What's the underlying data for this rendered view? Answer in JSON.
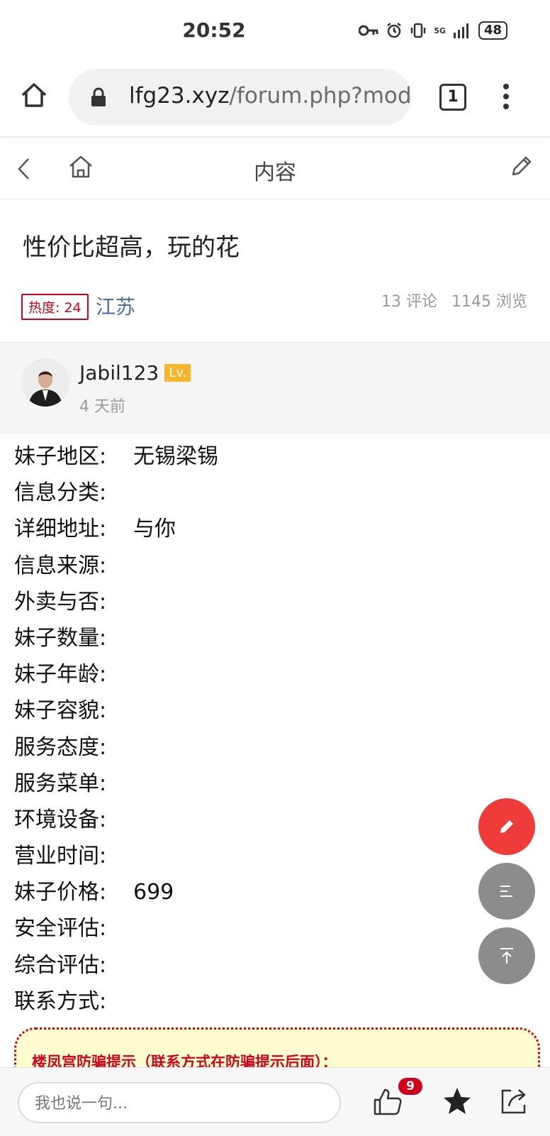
{
  "status_bar": {
    "time": "20:52",
    "network": "5G",
    "battery": "48"
  },
  "browser": {
    "url_domain": "lfg23.xyz",
    "url_path": "/forum.php?mod",
    "tab_count": "1"
  },
  "nav": {
    "title": "内容"
  },
  "post": {
    "title": "性价比超高，玩的花",
    "heat": "热度: 24",
    "region": "江苏",
    "comments": "13 评论",
    "views": "1145 浏览"
  },
  "author": {
    "name": "Jabil123",
    "level": "Lv.",
    "time": "4 天前"
  },
  "fields": [
    {
      "label": "妹子地区:",
      "value": "无锡梁锡"
    },
    {
      "label": "信息分类:",
      "value": ""
    },
    {
      "label": "详细地址:",
      "value": "与你"
    },
    {
      "label": "信息来源:",
      "value": ""
    },
    {
      "label": "外卖与否:",
      "value": ""
    },
    {
      "label": "妹子数量:",
      "value": ""
    },
    {
      "label": "妹子年龄:",
      "value": ""
    },
    {
      "label": "妹子容貌:",
      "value": ""
    },
    {
      "label": "服务态度:",
      "value": ""
    },
    {
      "label": "服务菜单:",
      "value": ""
    },
    {
      "label": "环境设备:",
      "value": ""
    },
    {
      "label": "营业时间:",
      "value": ""
    },
    {
      "label": "妹子价格:",
      "value": "699"
    },
    {
      "label": "安全评估:",
      "value": ""
    },
    {
      "label": "综合评估:",
      "value": ""
    },
    {
      "label": "联系方式:",
      "value": ""
    }
  ],
  "notice": {
    "title": "楼凤宫防骗提示（联系方式在防骗提示后面）："
  },
  "bottom": {
    "comment_placeholder": "我也说一句...",
    "like_count": "9"
  },
  "colors": {
    "accent_red": "#d0021b",
    "fab_red": "#f03b3b",
    "fab_gray": "#8c8c8c",
    "link_blue": "#4a6fa5",
    "level_orange": "#f7b52c",
    "notice_bg": "#fffdd0"
  }
}
